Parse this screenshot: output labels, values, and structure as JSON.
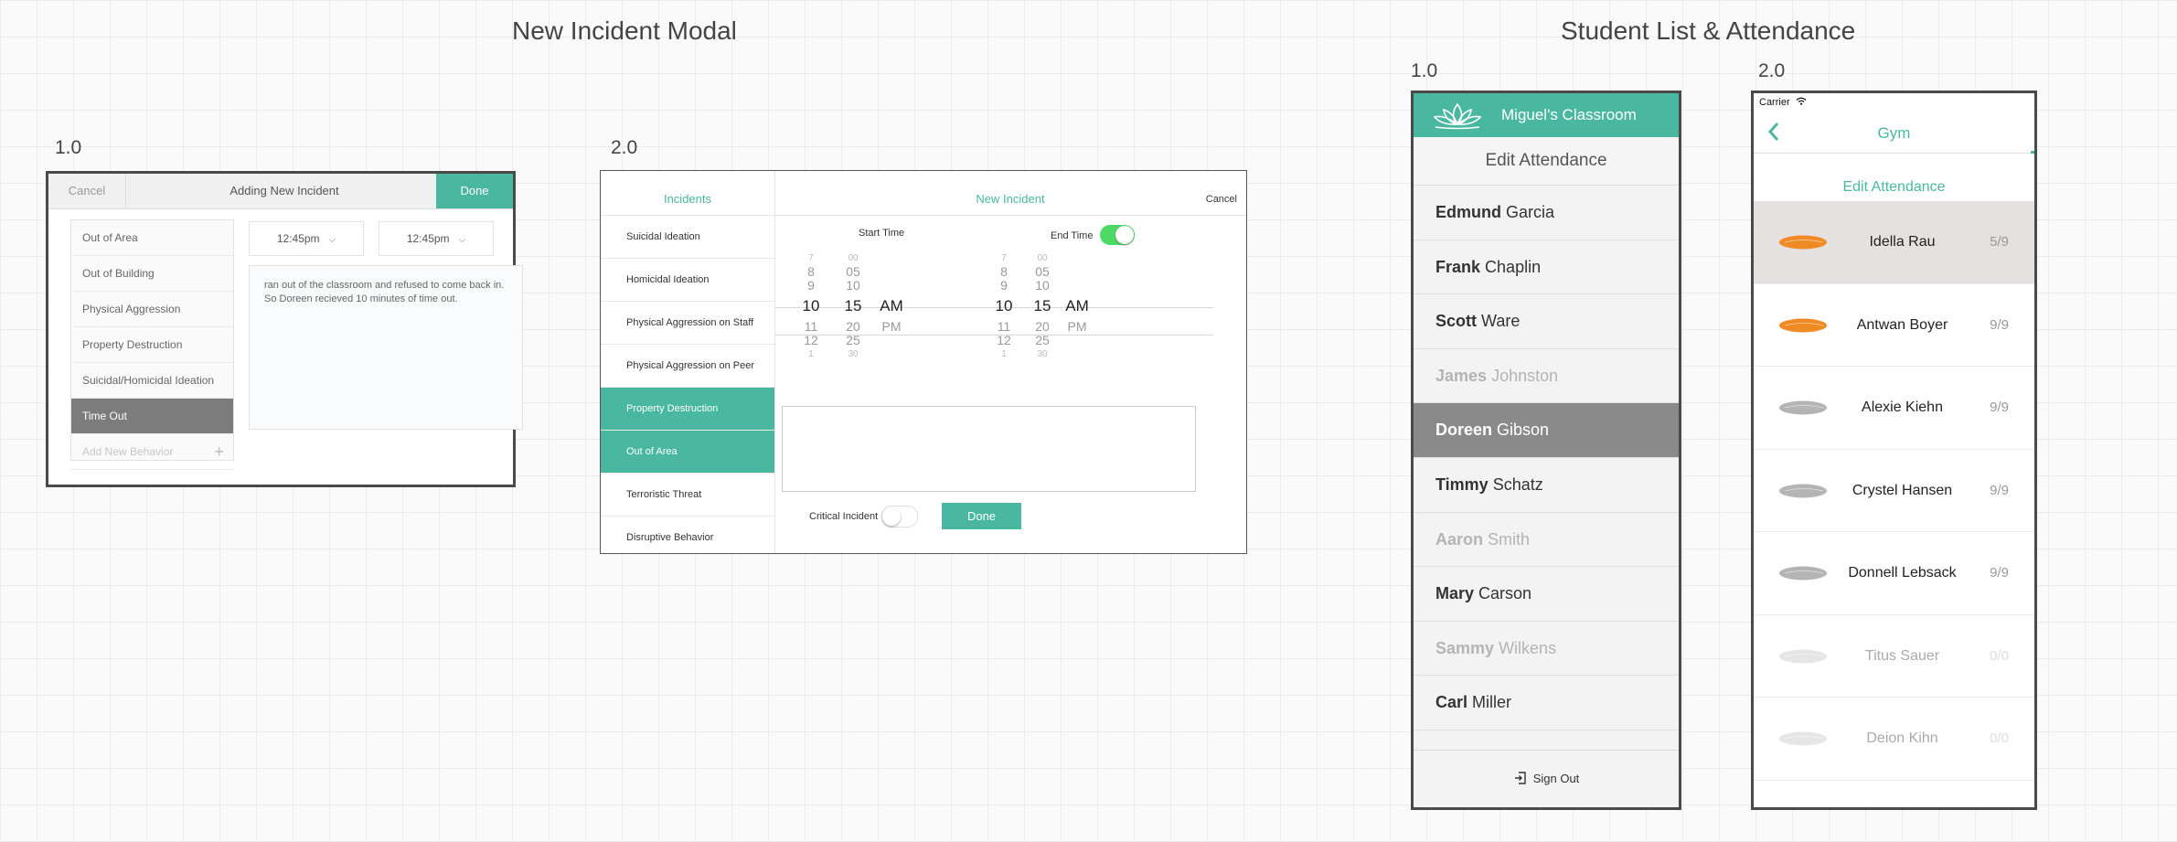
{
  "titles": {
    "incident_modal": "New Incident Modal",
    "student_list": "Student List & Attendance"
  },
  "versions": {
    "v1": "1.0",
    "v2": "2.0"
  },
  "incident_v1": {
    "cancel": "Cancel",
    "title": "Adding New Incident",
    "done": "Done",
    "behaviors": [
      {
        "label": "Out of Area",
        "selected": false
      },
      {
        "label": "Out of Building",
        "selected": false
      },
      {
        "label": "Physical Aggression",
        "selected": false
      },
      {
        "label": "Property Destruction",
        "selected": false
      },
      {
        "label": "Suicidal/Homicidal Ideation",
        "selected": false
      },
      {
        "label": "Time Out",
        "selected": true
      }
    ],
    "add_behavior": "Add New Behavior",
    "add_icon": "+",
    "start_time": "12:45pm",
    "end_time": "12:45pm",
    "note": "ran out of the classroom and refused to come back in. So Doreen recieved 10 minutes of time out."
  },
  "incident_v2": {
    "list_header": "Incidents",
    "header_title": "New Incident",
    "cancel": "Cancel",
    "incidents": [
      {
        "label": "Suicidal Ideation",
        "selected": false
      },
      {
        "label": "Homicidal Ideation",
        "selected": false
      },
      {
        "label": "Physical Aggression on Staff",
        "selected": false
      },
      {
        "label": "Physical Aggression on Peer",
        "selected": false
      },
      {
        "label": "Property Destruction",
        "selected": true
      },
      {
        "label": "Out of Area",
        "selected": true
      },
      {
        "label": "Terroristic Threat",
        "selected": false
      },
      {
        "label": "Disruptive Behavior",
        "selected": false
      }
    ],
    "start_time_label": "Start Time",
    "end_time_label": "End Time",
    "end_time_enabled": true,
    "start_picker": {
      "hours": [
        "7",
        "8",
        "9",
        "10",
        "11",
        "12",
        "1"
      ],
      "minutes": [
        "00",
        "05",
        "10",
        "15",
        "20",
        "25",
        "30"
      ],
      "ampm": [
        "AM",
        "PM"
      ]
    },
    "end_picker": {
      "hours": [
        "7",
        "8",
        "9",
        "10",
        "11",
        "12",
        "1"
      ],
      "minutes": [
        "00",
        "05",
        "10",
        "15",
        "20",
        "25",
        "30"
      ],
      "ampm": [
        "AM",
        "PM"
      ]
    },
    "critical_label": "Critical Incident",
    "critical_enabled": false,
    "done": "Done",
    "accent": "#4ab8a1"
  },
  "student_list_v1": {
    "classroom": "Miguel's Classroom",
    "subtitle": "Edit Attendance",
    "students": [
      {
        "first": "Edmund",
        "last": "Garcia",
        "state": "normal"
      },
      {
        "first": "Frank",
        "last": "Chaplin",
        "state": "normal"
      },
      {
        "first": "Scott",
        "last": "Ware",
        "state": "normal"
      },
      {
        "first": "James",
        "last": "Johnston",
        "state": "faded"
      },
      {
        "first": "Doreen",
        "last": "Gibson",
        "state": "selected"
      },
      {
        "first": "Timmy",
        "last": "Schatz",
        "state": "normal"
      },
      {
        "first": "Aaron",
        "last": "Smith",
        "state": "faded"
      },
      {
        "first": "Mary",
        "last": "Carson",
        "state": "normal"
      },
      {
        "first": "Sammy",
        "last": "Wilkens",
        "state": "faded"
      },
      {
        "first": "Carl",
        "last": "Miller",
        "state": "normal"
      }
    ],
    "sign_out": "Sign Out"
  },
  "student_list_v2": {
    "carrier": "Carrier",
    "title": "Gym",
    "subtitle": "Edit Attendance",
    "students": [
      {
        "name": "Idella Rau",
        "score": "5/9",
        "leaf": "orange",
        "selected": true
      },
      {
        "name": "Antwan Boyer",
        "score": "9/9",
        "leaf": "orange",
        "selected": false
      },
      {
        "name": "Alexie Kiehn",
        "score": "9/9",
        "leaf": "grey",
        "selected": false
      },
      {
        "name": "Crystel Hansen",
        "score": "9/9",
        "leaf": "grey",
        "selected": false
      },
      {
        "name": "Donnell Lebsack",
        "score": "9/9",
        "leaf": "grey",
        "selected": false
      },
      {
        "name": "Titus Sauer",
        "score": "0/0",
        "leaf": "light",
        "selected": false
      },
      {
        "name": "Deion Kihn",
        "score": "0/0",
        "leaf": "light",
        "selected": false
      }
    ],
    "leaf_colors": {
      "orange": "#f08a24",
      "grey": "#b4b4b4",
      "light": "#e6e6e6"
    }
  }
}
